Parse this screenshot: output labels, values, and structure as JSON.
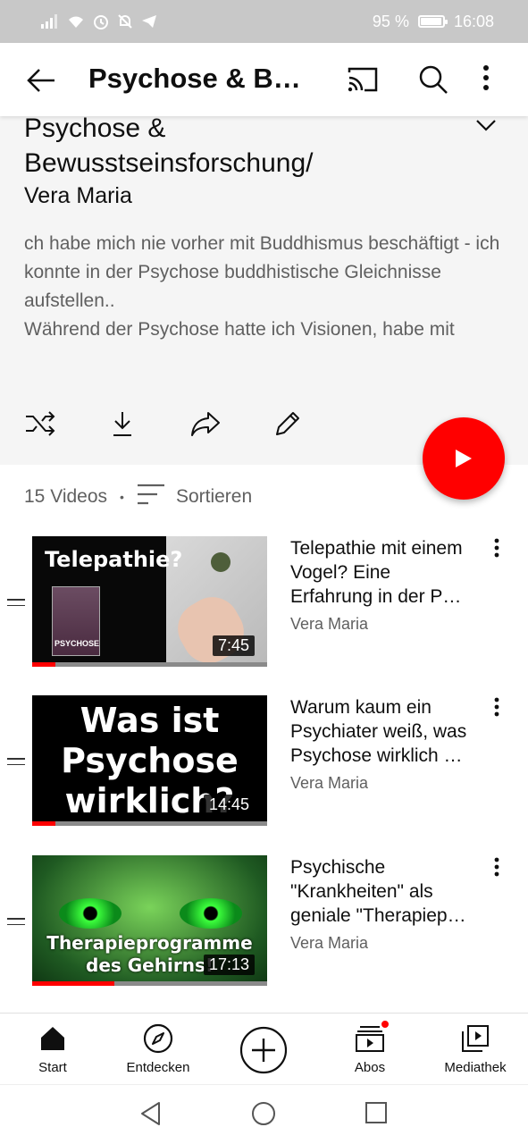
{
  "status_bar": {
    "battery": "95 %",
    "battery_level": 0.95,
    "time": "16:08"
  },
  "app_bar": {
    "title": "Psychose & B…"
  },
  "playlist": {
    "title": "Psychose & Bewusstseinsforschung/",
    "owner": "Vera Maria",
    "description": "ch habe mich nie vorher mit Buddhismus beschäftigt - ich konnte in der Psychose buddhistische Gleichnisse aufstellen..\nWährend der Psychose hatte ich Visionen, habe mit",
    "video_count": "15 Videos",
    "sort_label": "Sortieren"
  },
  "colors": {
    "accent": "#ff0000",
    "text_secondary": "#606060",
    "header_bg": "#f5f5f5"
  },
  "videos": [
    {
      "title": "Telepathie mit einem Vogel?  Eine Erfahrung in der  P…",
      "channel": "Vera Maria",
      "duration": "7:45",
      "progress": 0.1,
      "thumb_text": "Telepathie?",
      "book_text": "PSYCHOSE"
    },
    {
      "title": "Warum kaum ein Psychiater weiß, was Psychose wirklich …",
      "channel": "Vera Maria",
      "duration": "14:45",
      "progress": 0.1,
      "thumb_text_lines": [
        "Was ist",
        "Psychose",
        "wirklich?"
      ]
    },
    {
      "title": "Psychische \"Krankheiten\" als geniale \"Therapiep…",
      "channel": "Vera Maria",
      "duration": "17:13",
      "progress": 0.35,
      "thumb_text_lines": [
        "Therapieprogramme",
        "des Gehirns!"
      ]
    }
  ],
  "bottom_nav": [
    {
      "label": "Start",
      "icon": "home-icon"
    },
    {
      "label": "Entdecken",
      "icon": "compass-icon"
    },
    {
      "label": "",
      "icon": "create-icon"
    },
    {
      "label": "Abos",
      "icon": "subscriptions-icon"
    },
    {
      "label": "Mediathek",
      "icon": "library-icon"
    }
  ]
}
